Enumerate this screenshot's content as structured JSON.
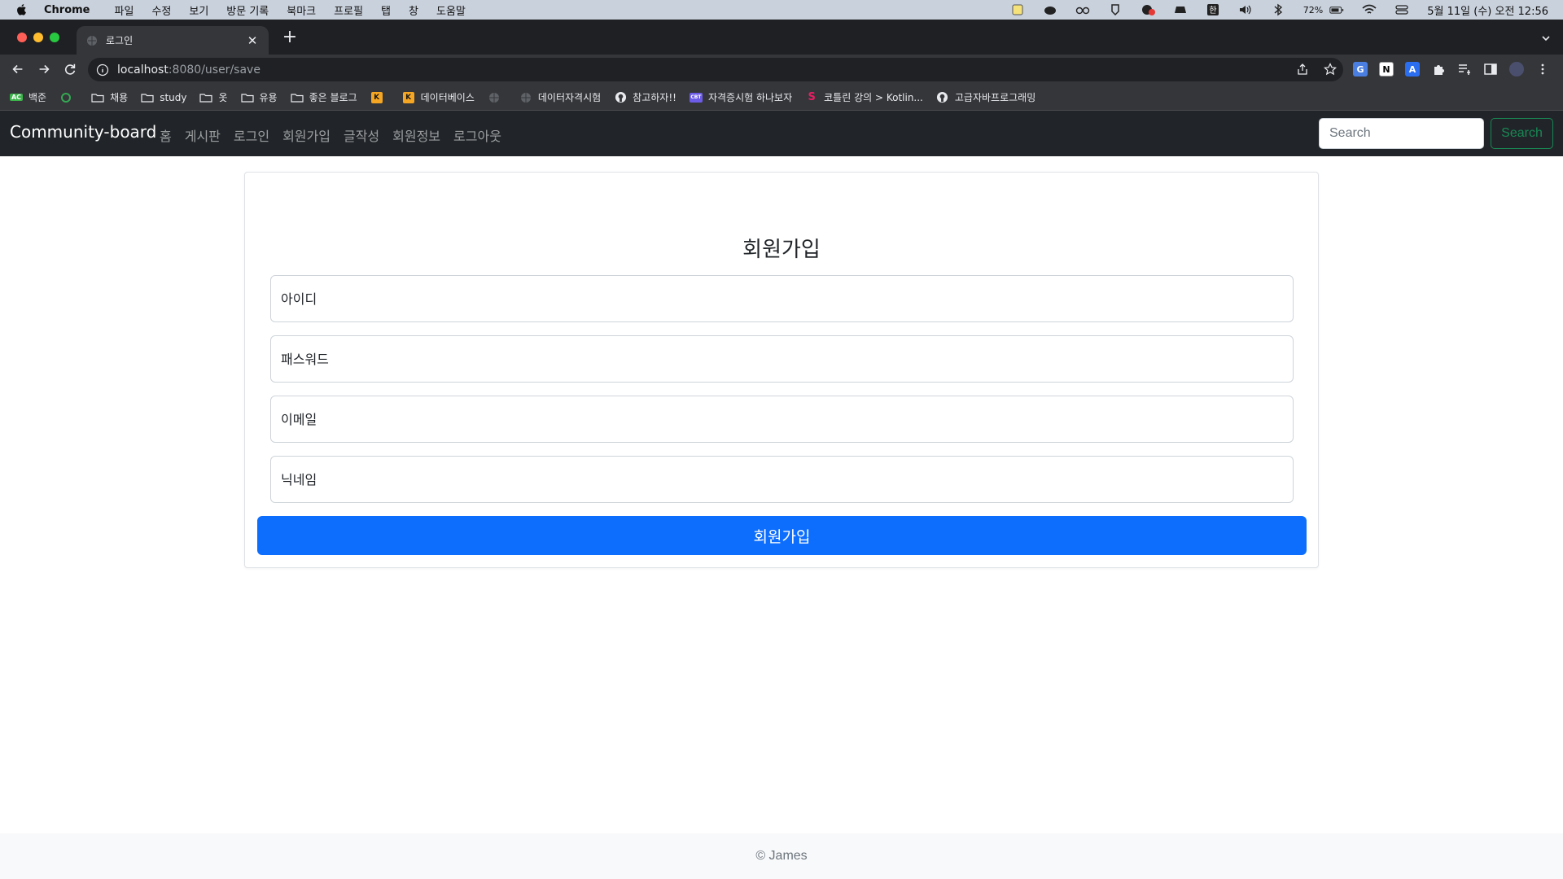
{
  "mac_menubar": {
    "app_name": "Chrome",
    "menus": [
      "파일",
      "수정",
      "보기",
      "방문 기록",
      "북마크",
      "프로필",
      "탭",
      "창",
      "도움말"
    ],
    "battery": "72%",
    "clock": "5월 11일 (수) 오전 12:56"
  },
  "browser": {
    "tab_title": "로그인",
    "url_host": "localhost",
    "url_rest": ":8080/user/save",
    "bookmarks": [
      {
        "label": "백준",
        "icon": "baekjoon-icon"
      },
      {
        "label": "",
        "icon": "green-circle-icon"
      },
      {
        "label": "채용",
        "icon": "folder-icon"
      },
      {
        "label": "study",
        "icon": "folder-icon"
      },
      {
        "label": "옷",
        "icon": "folder-icon"
      },
      {
        "label": "유용",
        "icon": "folder-icon"
      },
      {
        "label": "좋은 블로그",
        "icon": "folder-icon"
      },
      {
        "label": "",
        "icon": "k-icon"
      },
      {
        "label": "데이터베이스",
        "icon": "k-icon"
      },
      {
        "label": "",
        "icon": "globe-icon"
      },
      {
        "label": "데이터자격시험",
        "icon": "globe-icon"
      },
      {
        "label": "참고하자!!",
        "icon": "github-icon"
      },
      {
        "label": "자격증시험 하나보자",
        "icon": "cbt-icon"
      },
      {
        "label": "코틀린 강의 > Kotlin...",
        "icon": "s-icon"
      },
      {
        "label": "고급자바프로그래밍",
        "icon": "github-icon"
      }
    ]
  },
  "navbar": {
    "brand": "Community-board",
    "links": [
      "홈",
      "게시판",
      "로그인",
      "회원가입",
      "글작성",
      "회원정보",
      "로그아웃"
    ],
    "search_placeholder": "Search",
    "search_button": "Search"
  },
  "form": {
    "title": "회원가입",
    "fields": {
      "username_placeholder": "아이디",
      "password_placeholder": "패스워드",
      "email_placeholder": "이메일",
      "nickname_placeholder": "닉네임"
    },
    "submit_label": "회원가입"
  },
  "footer": {
    "text": "© James"
  },
  "colors": {
    "navbar_bg": "#212529",
    "primary": "#0d6efd",
    "success": "#198754"
  }
}
